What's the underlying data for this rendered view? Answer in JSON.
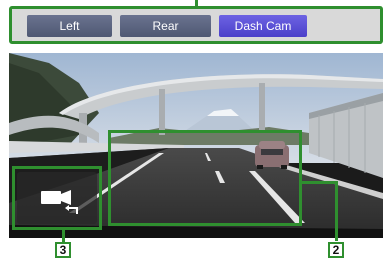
{
  "tabs": {
    "left_label": "Left",
    "rear_label": "Rear",
    "dashcam_label": "Dash Cam",
    "active": "Dash Cam"
  },
  "callouts": {
    "box2": "2",
    "box3": "3"
  },
  "icons": {
    "camera_switch": "camera-switch-icon"
  },
  "colors": {
    "highlight": "#2f8f2f",
    "tab_inactive": "#5c6580",
    "tab_active": "#5a4fd9"
  }
}
